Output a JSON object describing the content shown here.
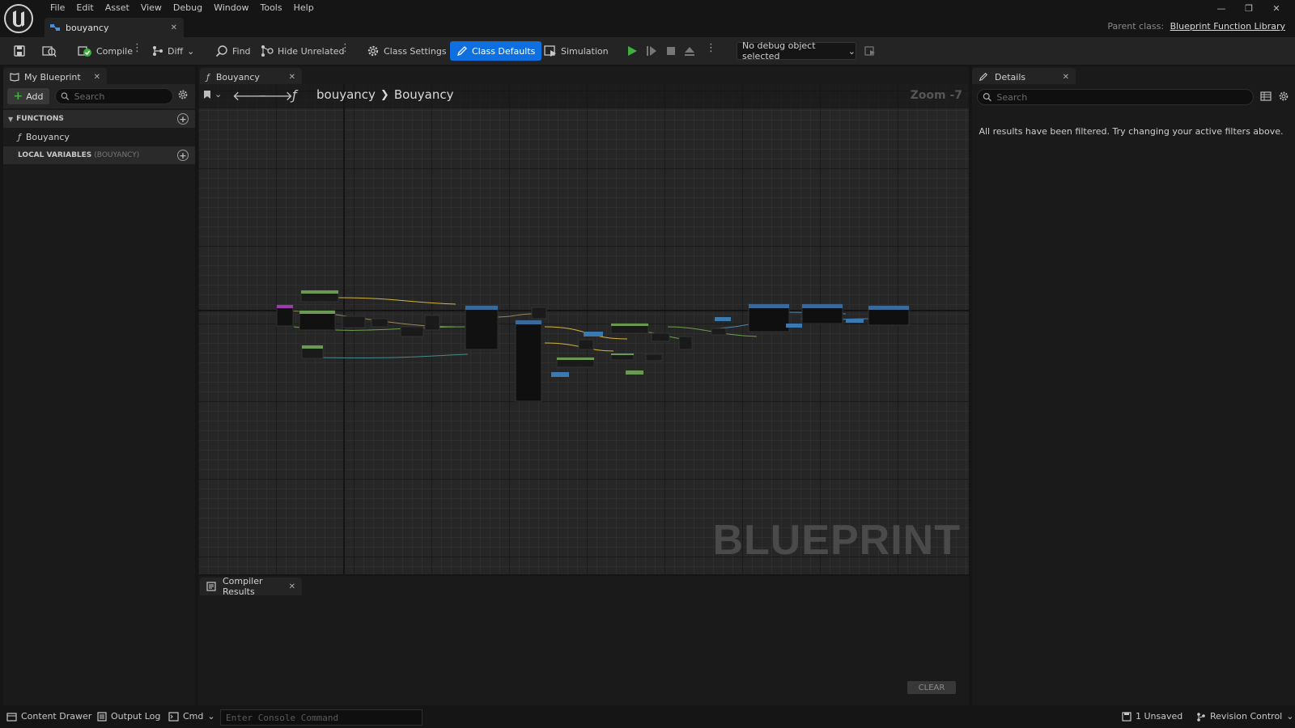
{
  "menu": [
    "File",
    "Edit",
    "Asset",
    "View",
    "Debug",
    "Window",
    "Tools",
    "Help"
  ],
  "document_tab": {
    "label": "bouyancy"
  },
  "parent_class": {
    "label": "Parent class:",
    "value": "Blueprint Function Library"
  },
  "toolbar": {
    "compile": "Compile",
    "diff": "Diff",
    "find": "Find",
    "hide_unrelated": "Hide Unrelated",
    "class_settings": "Class Settings",
    "class_defaults": "Class Defaults",
    "simulation": "Simulation",
    "debug_object": "No debug object selected"
  },
  "my_blueprint": {
    "tab": "My Blueprint",
    "add": "Add",
    "search_placeholder": "Search",
    "functions_header": "FUNCTIONS",
    "functions": [
      "Bouyancy"
    ],
    "local_vars_header": "LOCAL VARIABLES",
    "local_vars_sub": "(BOUYANCY)"
  },
  "graph": {
    "tab": "Bouyancy",
    "breadcrumb": [
      "bouyancy",
      "Bouyancy"
    ],
    "zoom": "Zoom -7",
    "watermark": "BLUEPRINT"
  },
  "compiler": {
    "tab": "Compiler Results",
    "clear": "CLEAR"
  },
  "details": {
    "tab": "Details",
    "search_placeholder": "Search",
    "message": "All results have been filtered. Try changing your active filters above."
  },
  "statusbar": {
    "content_drawer": "Content Drawer",
    "output_log": "Output Log",
    "cmd": "Cmd",
    "console_placeholder": "Enter Console Command",
    "unsaved": "1 Unsaved",
    "revision_control": "Revision Control"
  },
  "colors": {
    "accent": "#0e70e0",
    "play": "#3fb03f"
  }
}
